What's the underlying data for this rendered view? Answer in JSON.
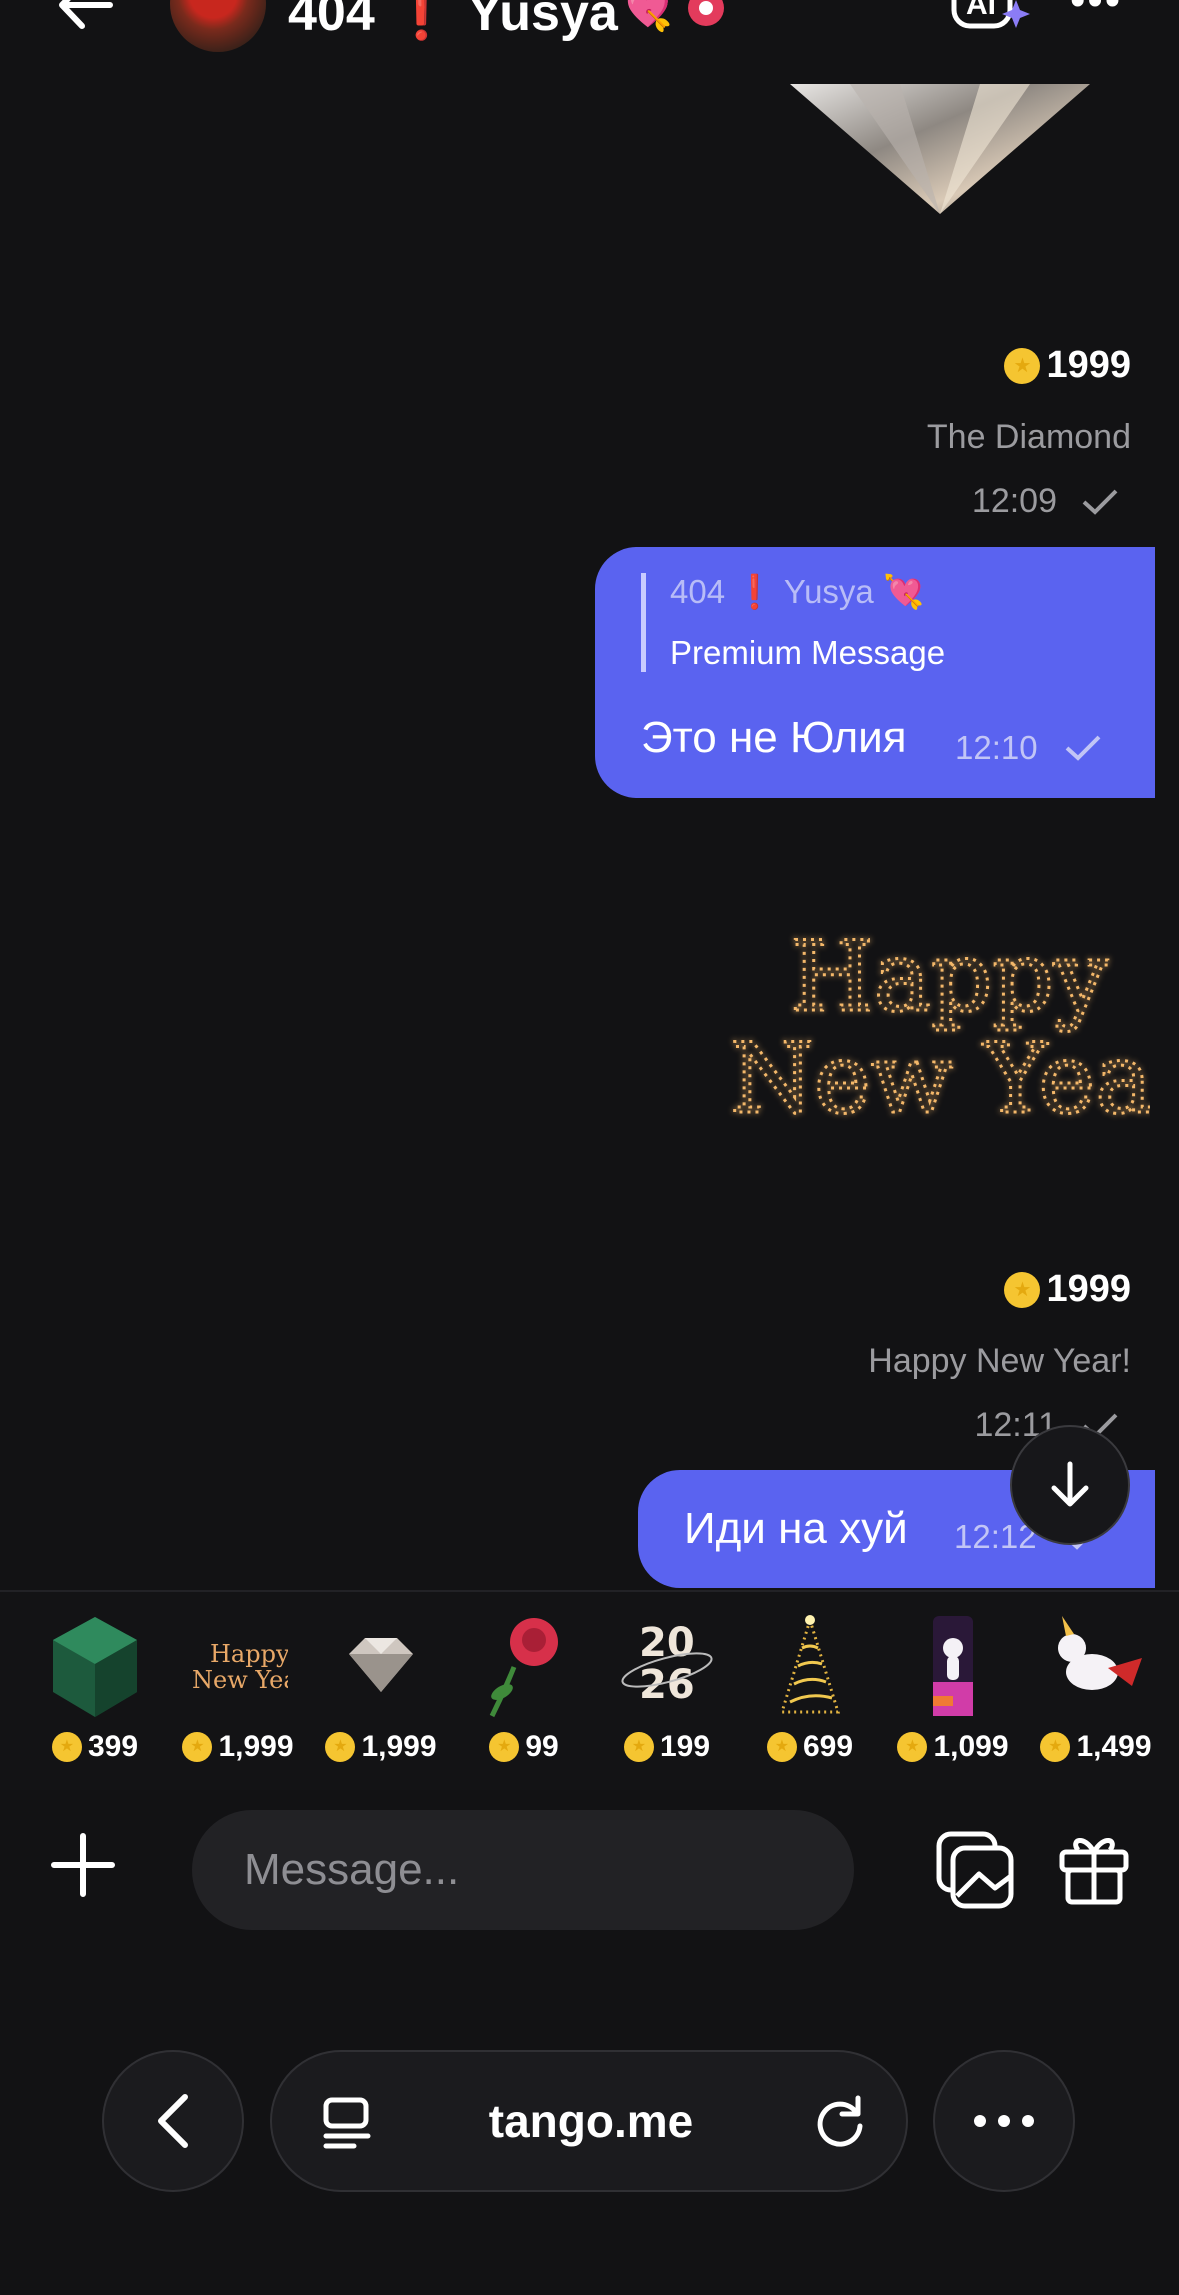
{
  "header": {
    "title": "404 ❗ Yusya",
    "title_emoji": "💘",
    "ai_label": "AI"
  },
  "gift_messages": [
    {
      "gift_name": "The Diamond",
      "price": "1999",
      "time": "12:09"
    },
    {
      "gift_name": "Happy New Year!",
      "price": "1999",
      "time": "12:11",
      "art_text_line1": "Happy",
      "art_text_line2": "New Year"
    }
  ],
  "messages": [
    {
      "reply_author": "404 ❗ Yusya 💘",
      "reply_text": "Premium Message",
      "text": "Это не Юлия",
      "time": "12:10"
    },
    {
      "text": "Иди на хуй",
      "time": "12:12"
    }
  ],
  "gift_strip": [
    {
      "icon": "cube-gift-icon",
      "price": "399"
    },
    {
      "icon": "happy-new-year-gift-icon",
      "price": "1,999",
      "art_line1": "Happy",
      "art_line2": "New Year"
    },
    {
      "icon": "diamond-gift-icon",
      "price": "1,999"
    },
    {
      "icon": "rose-gift-icon",
      "price": "99"
    },
    {
      "icon": "year-2026-gift-icon",
      "price": "199",
      "art_line1": "20",
      "art_line2": "26"
    },
    {
      "icon": "christmas-tree-gift-icon",
      "price": "699"
    },
    {
      "icon": "unicorn-dance-gift-icon",
      "price": "1,099"
    },
    {
      "icon": "flying-unicorn-gift-icon",
      "price": "1,499"
    }
  ],
  "composer": {
    "placeholder": "Message..."
  },
  "browser": {
    "url": "tango.me"
  },
  "colors": {
    "background": "#121214",
    "bubble": "#5a63f0",
    "coin": "#f5c531",
    "muted_text": "#9b9b9f"
  }
}
